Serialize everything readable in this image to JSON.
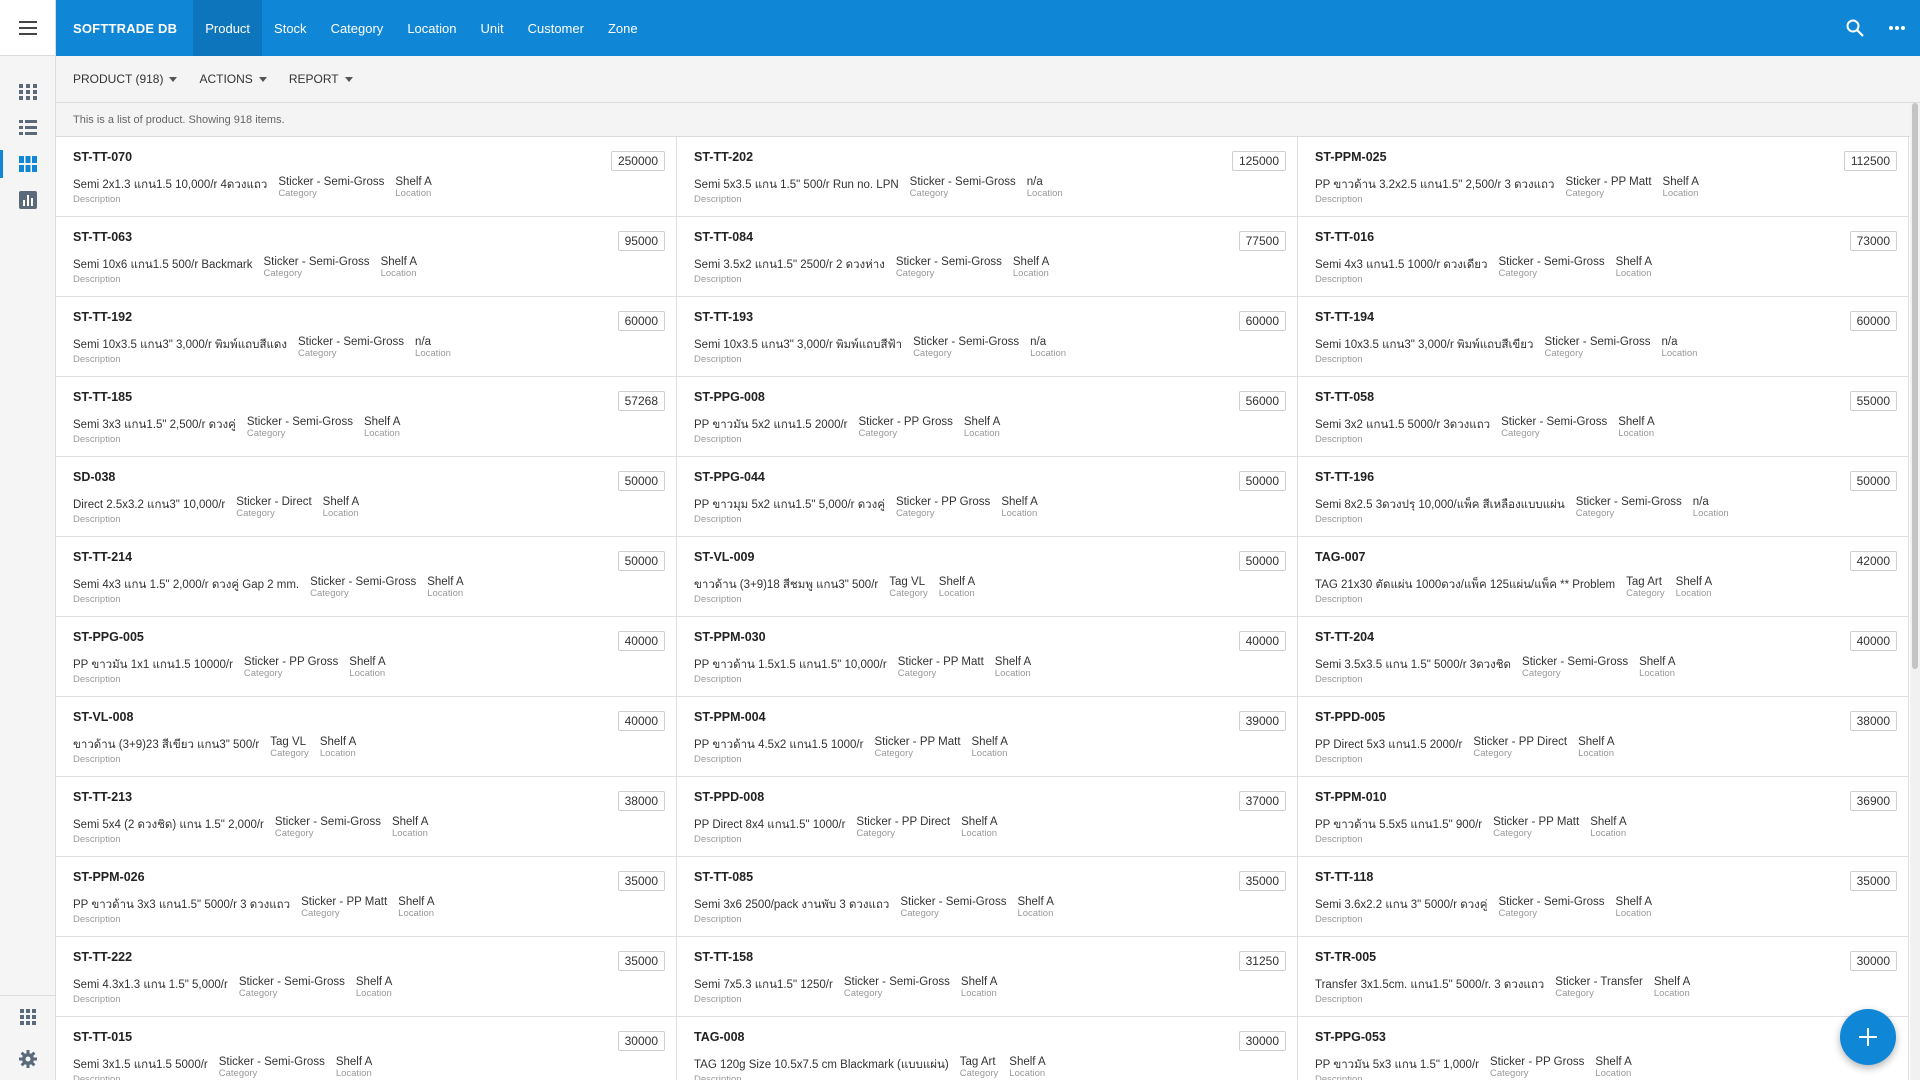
{
  "app": {
    "brand": "SOFTTRADE DB"
  },
  "nav": [
    {
      "label": "Product",
      "active": true
    },
    {
      "label": "Stock"
    },
    {
      "label": "Category"
    },
    {
      "label": "Location"
    },
    {
      "label": "Unit"
    },
    {
      "label": "Customer"
    },
    {
      "label": "Zone"
    }
  ],
  "toolbar": {
    "product": "PRODUCT (918)",
    "actions": "ACTIONS",
    "report": "REPORT"
  },
  "info": "This is a list of product. Showing 918 items.",
  "labels": {
    "description": "Description",
    "category": "Category",
    "location": "Location"
  },
  "icons": {
    "rail": [
      "menu-icon",
      "module-grid-icon",
      "list-view-icon",
      "card-view-icon",
      "chart-icon"
    ],
    "rail_bottom": [
      "apps-icon",
      "settings-icon"
    ],
    "top_right": [
      "search-icon",
      "more-icon"
    ],
    "fab": "add-icon"
  },
  "colors": {
    "primary": "#0f86d6",
    "rail_bg": "#f5f5f5",
    "toolbar_bg": "#f4f4f4"
  },
  "products": [
    {
      "code": "ST-TT-070",
      "qty": "250000",
      "desc": "Semi 2x1.3 แกน1.5 10,000/r 4ดวงแถว",
      "category": "Sticker - Semi-Gross",
      "location": "Shelf A"
    },
    {
      "code": "ST-TT-202",
      "qty": "125000",
      "desc": "Semi 5x3.5 แกน 1.5\" 500/r Run no. LPN",
      "category": "Sticker - Semi-Gross",
      "location": "n/a"
    },
    {
      "code": "ST-PPM-025",
      "qty": "112500",
      "desc": "PP ขาวด้าน 3.2x2.5 แกน1.5\" 2,500/r 3 ดวงแถว",
      "category": "Sticker - PP Matt",
      "location": "Shelf A"
    },
    {
      "code": "ST-TT-063",
      "qty": "95000",
      "desc": "Semi 10x6 แกน1.5 500/r Backmark",
      "category": "Sticker - Semi-Gross",
      "location": "Shelf A"
    },
    {
      "code": "ST-TT-084",
      "qty": "77500",
      "desc": "Semi 3.5x2 แกน1.5\" 2500/r 2 ดวงห่าง",
      "category": "Sticker - Semi-Gross",
      "location": "Shelf A"
    },
    {
      "code": "ST-TT-016",
      "qty": "73000",
      "desc": "Semi 4x3 แกน1.5 1000/r ดวงเดียว",
      "category": "Sticker - Semi-Gross",
      "location": "Shelf A"
    },
    {
      "code": "ST-TT-192",
      "qty": "60000",
      "desc": "Semi 10x3.5 แกน3\" 3,000/r พิมพ์แถบสีแดง",
      "category": "Sticker - Semi-Gross",
      "location": "n/a"
    },
    {
      "code": "ST-TT-193",
      "qty": "60000",
      "desc": "Semi 10x3.5 แกน3\" 3,000/r พิมพ์แถบสีฟ้า",
      "category": "Sticker - Semi-Gross",
      "location": "n/a"
    },
    {
      "code": "ST-TT-194",
      "qty": "60000",
      "desc": "Semi 10x3.5 แกน3\" 3,000/r พิมพ์แถบสีเขียว",
      "category": "Sticker - Semi-Gross",
      "location": "n/a"
    },
    {
      "code": "ST-TT-185",
      "qty": "57268",
      "desc": "Semi 3x3 แกน1.5\" 2,500/r ดวงคู่",
      "category": "Sticker - Semi-Gross",
      "location": "Shelf A"
    },
    {
      "code": "ST-PPG-008",
      "qty": "56000",
      "desc": "PP ขาวมัน 5x2 แกน1.5 2000/r",
      "category": "Sticker - PP Gross",
      "location": "Shelf A"
    },
    {
      "code": "ST-TT-058",
      "qty": "55000",
      "desc": "Semi 3x2 แกน1.5 5000/r 3ดวงแถว",
      "category": "Sticker - Semi-Gross",
      "location": "Shelf A"
    },
    {
      "code": "SD-038",
      "qty": "50000",
      "desc": "Direct 2.5x3.2 แกน3\" 10,000/r",
      "category": "Sticker - Direct",
      "location": "Shelf A"
    },
    {
      "code": "ST-PPG-044",
      "qty": "50000",
      "desc": "PP ขาวมุม 5x2 แกน1.5\" 5,000/r ดวงคู่",
      "category": "Sticker - PP Gross",
      "location": "Shelf A"
    },
    {
      "code": "ST-TT-196",
      "qty": "50000",
      "desc": "Semi 8x2.5 3ดวงปรุ 10,000/แพ็ค สีเหลืองแบบแผ่น",
      "category": "Sticker - Semi-Gross",
      "location": "n/a"
    },
    {
      "code": "ST-TT-214",
      "qty": "50000",
      "desc": "Semi 4x3 แกน 1.5\" 2,000/r ดวงคู่ Gap 2 mm.",
      "category": "Sticker - Semi-Gross",
      "location": "Shelf A"
    },
    {
      "code": "ST-VL-009",
      "qty": "50000",
      "desc": "ขาวด้าน (3+9)18 สีชมพู แกน3\" 500/r",
      "category": "Tag VL",
      "location": "Shelf A"
    },
    {
      "code": "TAG-007",
      "qty": "42000",
      "desc": "TAG 21x30 ตัดแผ่น 1000ดวง/แพ็ค 125แผ่น/แพ็ค ** Problem",
      "category": "Tag Art",
      "location": "Shelf A"
    },
    {
      "code": "ST-PPG-005",
      "qty": "40000",
      "desc": "PP ขาวมัน 1x1 แกน1.5 10000/r",
      "category": "Sticker - PP Gross",
      "location": "Shelf A"
    },
    {
      "code": "ST-PPM-030",
      "qty": "40000",
      "desc": "PP ขาวด้าน 1.5x1.5 แกน1.5\" 10,000/r",
      "category": "Sticker - PP Matt",
      "location": "Shelf A"
    },
    {
      "code": "ST-TT-204",
      "qty": "40000",
      "desc": "Semi 3.5x3.5 แกน 1.5\" 5000/r 3ดวงชิด",
      "category": "Sticker - Semi-Gross",
      "location": "Shelf A"
    },
    {
      "code": "ST-VL-008",
      "qty": "40000",
      "desc": "ขาวด้าน (3+9)23 สีเขียว แกน3\" 500/r",
      "category": "Tag VL",
      "location": "Shelf A"
    },
    {
      "code": "ST-PPM-004",
      "qty": "39000",
      "desc": "PP ขาวด้าน 4.5x2 แกน1.5 1000/r",
      "category": "Sticker - PP Matt",
      "location": "Shelf A"
    },
    {
      "code": "ST-PPD-005",
      "qty": "38000",
      "desc": "PP Direct 5x3 แกน1.5 2000/r",
      "category": "Sticker - PP Direct",
      "location": "Shelf A"
    },
    {
      "code": "ST-TT-213",
      "qty": "38000",
      "desc": "Semi 5x4 (2 ดวงชิด) แกน 1.5\" 2,000/r",
      "category": "Sticker - Semi-Gross",
      "location": "Shelf A"
    },
    {
      "code": "ST-PPD-008",
      "qty": "37000",
      "desc": "PP Direct 8x4 แกน1.5\" 1000/r",
      "category": "Sticker - PP Direct",
      "location": "Shelf A"
    },
    {
      "code": "ST-PPM-010",
      "qty": "36900",
      "desc": "PP ขาวด้าน 5.5x5 แกน1.5\" 900/r",
      "category": "Sticker - PP Matt",
      "location": "Shelf A"
    },
    {
      "code": "ST-PPM-026",
      "qty": "35000",
      "desc": "PP ขาวด้าน 3x3 แกน1.5\" 5000/r 3 ดวงแถว",
      "category": "Sticker - PP Matt",
      "location": "Shelf A"
    },
    {
      "code": "ST-TT-085",
      "qty": "35000",
      "desc": "Semi 3x6 2500/pack งานพับ 3 ดวงแถว",
      "category": "Sticker - Semi-Gross",
      "location": "Shelf A"
    },
    {
      "code": "ST-TT-118",
      "qty": "35000",
      "desc": "Semi 3.6x2.2 แกน 3\" 5000/r ดวงคู่",
      "category": "Sticker - Semi-Gross",
      "location": "Shelf A"
    },
    {
      "code": "ST-TT-222",
      "qty": "35000",
      "desc": "Semi 4.3x1.3 แกน 1.5\" 5,000/r",
      "category": "Sticker - Semi-Gross",
      "location": "Shelf A"
    },
    {
      "code": "ST-TT-158",
      "qty": "31250",
      "desc": "Semi 7x5.3 แกน1.5\" 1250/r",
      "category": "Sticker - Semi-Gross",
      "location": "Shelf A"
    },
    {
      "code": "ST-TR-005",
      "qty": "30000",
      "desc": "Transfer 3x1.5cm. แกน1.5\" 5000/r. 3 ดวงแถว",
      "category": "Sticker - Transfer",
      "location": "Shelf A"
    },
    {
      "code": "ST-TT-015",
      "qty": "30000",
      "desc": "Semi 3x1.5 แกน1.5 5000/r",
      "category": "Sticker - Semi-Gross",
      "location": "Shelf A"
    },
    {
      "code": "TAG-008",
      "qty": "30000",
      "desc": "TAG 120g Size 10.5x7.5 cm Blackmark (แบบแผ่น)",
      "category": "Tag Art",
      "location": "Shelf A"
    },
    {
      "code": "ST-PPG-053",
      "qty": "",
      "desc": "PP ขาวมัน 5x3 แกน 1.5\" 1,000/r",
      "category": "Sticker - PP Gross",
      "location": "Shelf A"
    }
  ]
}
